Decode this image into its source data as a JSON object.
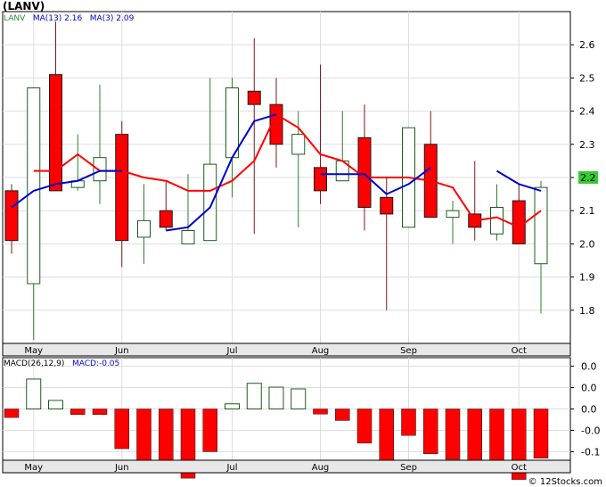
{
  "title": "(LANV)",
  "legend": {
    "symbol": "LANV",
    "ma13": "MA(13)  2.16",
    "ma3": "MA(3)  2.09",
    "macd_params": "MACD(26,12,9)",
    "macd_value": "MACD:-0.05"
  },
  "copyright": "© 12Stocks.com",
  "colors": {
    "up": "#ffffff",
    "up_stroke": "#1a5c1a",
    "down": "#ff0000",
    "down_stroke": "#1a1a1a",
    "wick_up": "#2e7d2e",
    "wick_down": "#7a1a1a",
    "ma13": "#ff0000",
    "ma3": "#0000cc",
    "grid": "#dddddd",
    "price_tag_bg": "#33cc33"
  },
  "chart_data": [
    {
      "type": "candlestick",
      "name": "price",
      "ylim": [
        1.7,
        2.7
      ],
      "yticks": [
        1.8,
        1.9,
        2.0,
        2.1,
        2.2,
        2.3,
        2.4,
        2.5,
        2.6
      ],
      "yticklabels": [
        "1.8",
        "1.9",
        "2.0",
        "2.1",
        "2.2",
        "2.3",
        "2.4",
        "2.5",
        "2.6"
      ],
      "last_price_label": "2.2",
      "last_price": 2.2,
      "xticklabels": [
        "May",
        "Jun",
        "Jul",
        "Aug",
        "Sep",
        "Oct"
      ],
      "candles": [
        {
          "i": 0,
          "o": 2.16,
          "h": 2.18,
          "l": 1.97,
          "c": 2.01
        },
        {
          "i": 1,
          "o": 1.88,
          "h": 2.47,
          "l": 1.71,
          "c": 2.47
        },
        {
          "i": 2,
          "o": 2.51,
          "h": 2.67,
          "l": 2.16,
          "c": 2.16
        },
        {
          "i": 3,
          "o": 2.17,
          "h": 2.33,
          "l": 2.16,
          "c": 2.19
        },
        {
          "i": 4,
          "o": 2.19,
          "h": 2.48,
          "l": 2.12,
          "c": 2.26
        },
        {
          "i": 5,
          "o": 2.33,
          "h": 2.37,
          "l": 1.93,
          "c": 2.01
        },
        {
          "i": 6,
          "o": 2.02,
          "h": 2.18,
          "l": 1.94,
          "c": 2.07
        },
        {
          "i": 7,
          "o": 2.1,
          "h": 2.19,
          "l": 2.04,
          "c": 2.05
        },
        {
          "i": 8,
          "o": 2.0,
          "h": 2.21,
          "l": 2.0,
          "c": 2.04
        },
        {
          "i": 9,
          "o": 2.01,
          "h": 2.5,
          "l": 2.01,
          "c": 2.24
        },
        {
          "i": 10,
          "o": 2.26,
          "h": 2.5,
          "l": 2.14,
          "c": 2.47
        },
        {
          "i": 11,
          "o": 2.46,
          "h": 2.62,
          "l": 2.03,
          "c": 2.42
        },
        {
          "i": 12,
          "o": 2.42,
          "h": 2.5,
          "l": 2.23,
          "c": 2.3
        },
        {
          "i": 13,
          "o": 2.27,
          "h": 2.4,
          "l": 2.05,
          "c": 2.33
        },
        {
          "i": 14,
          "o": 2.23,
          "h": 2.54,
          "l": 2.12,
          "c": 2.16
        },
        {
          "i": 15,
          "o": 2.19,
          "h": 2.4,
          "l": 2.19,
          "c": 2.25
        },
        {
          "i": 16,
          "o": 2.32,
          "h": 2.42,
          "l": 2.04,
          "c": 2.11
        },
        {
          "i": 17,
          "o": 2.14,
          "h": 2.2,
          "l": 1.8,
          "c": 2.09
        },
        {
          "i": 18,
          "o": 2.05,
          "h": 2.35,
          "l": 2.05,
          "c": 2.35
        },
        {
          "i": 19,
          "o": 2.3,
          "h": 2.4,
          "l": 2.08,
          "c": 2.08
        },
        {
          "i": 20,
          "o": 2.08,
          "h": 2.13,
          "l": 2.0,
          "c": 2.1
        },
        {
          "i": 21,
          "o": 2.09,
          "h": 2.25,
          "l": 2.01,
          "c": 2.05
        },
        {
          "i": 22,
          "o": 2.03,
          "h": 2.18,
          "l": 2.01,
          "c": 2.11
        },
        {
          "i": 23,
          "o": 2.13,
          "h": 2.18,
          "l": 2.0,
          "c": 2.0
        },
        {
          "i": 24,
          "o": 1.94,
          "h": 2.19,
          "l": 1.79,
          "c": 2.17
        }
      ],
      "ma13": [
        {
          "i": 1,
          "v": 2.22
        },
        {
          "i": 2,
          "v": 2.22
        },
        {
          "i": 3,
          "v": 2.27
        },
        {
          "i": 4,
          "v": 2.22
        },
        {
          "i": 5,
          "v": 2.22
        },
        {
          "i": 6,
          "v": 2.2
        },
        {
          "i": 7,
          "v": 2.19
        },
        {
          "i": 8,
          "v": 2.16
        },
        {
          "i": 9,
          "v": 2.16
        },
        {
          "i": 10,
          "v": 2.19
        },
        {
          "i": 11,
          "v": 2.25
        },
        {
          "i": 12,
          "v": 2.39
        },
        {
          "i": 13,
          "v": 2.35
        },
        {
          "i": 14,
          "v": 2.27
        },
        {
          "i": 15,
          "v": 2.25
        },
        {
          "i": 16,
          "v": 2.2
        },
        {
          "i": 17,
          "v": 2.2
        },
        {
          "i": 18,
          "v": 2.2
        },
        {
          "i": 19,
          "v": 2.19
        },
        {
          "i": 20,
          "v": 2.17
        },
        {
          "i": 21,
          "v": 2.07
        },
        {
          "i": 22,
          "v": 2.08
        },
        {
          "i": 23,
          "v": 2.05
        },
        {
          "i": 24,
          "v": 2.1
        }
      ],
      "ma3": [
        {
          "i": 0,
          "v": 2.11
        },
        {
          "i": 1,
          "v": 2.16
        },
        {
          "i": 2,
          "v": 2.18
        },
        {
          "i": 3,
          "v": 2.19
        },
        {
          "i": 4,
          "v": 2.22
        },
        {
          "i": 5,
          "v": 2.22
        },
        {
          "i": 7,
          "v": 2.04
        },
        {
          "i": 8,
          "v": 2.05
        },
        {
          "i": 9,
          "v": 2.11
        },
        {
          "i": 10,
          "v": 2.26
        },
        {
          "i": 11,
          "v": 2.37
        },
        {
          "i": 12,
          "v": 2.39
        },
        {
          "i": 14,
          "v": 2.21
        },
        {
          "i": 15,
          "v": 2.21
        },
        {
          "i": 16,
          "v": 2.21
        },
        {
          "i": 17,
          "v": 2.15
        },
        {
          "i": 18,
          "v": 2.18
        },
        {
          "i": 19,
          "v": 2.23
        },
        {
          "i": 22,
          "v": 2.22
        },
        {
          "i": 23,
          "v": 2.18
        },
        {
          "i": 24,
          "v": 2.16
        }
      ]
    },
    {
      "type": "bar",
      "name": "macd",
      "ylim": [
        -0.12,
        0.12
      ],
      "yticks": [
        0.1,
        0.05,
        0.0,
        -0.05,
        -0.1
      ],
      "yticklabels": [
        "0.0",
        "0.0",
        "0.0",
        "-0.0",
        "-0.1"
      ],
      "values": [
        {
          "i": 0,
          "v": -0.02
        },
        {
          "i": 1,
          "v": 0.07
        },
        {
          "i": 2,
          "v": 0.02
        },
        {
          "i": 3,
          "v": -0.013
        },
        {
          "i": 4,
          "v": -0.013
        },
        {
          "i": 5,
          "v": -0.093
        },
        {
          "i": 6,
          "v": -0.127
        },
        {
          "i": 7,
          "v": -0.149
        },
        {
          "i": 8,
          "v": -0.162
        },
        {
          "i": 9,
          "v": -0.1
        },
        {
          "i": 10,
          "v": 0.012
        },
        {
          "i": 11,
          "v": 0.06
        },
        {
          "i": 12,
          "v": 0.051
        },
        {
          "i": 13,
          "v": 0.047
        },
        {
          "i": 14,
          "v": -0.012
        },
        {
          "i": 15,
          "v": -0.027
        },
        {
          "i": 16,
          "v": -0.08
        },
        {
          "i": 17,
          "v": -0.121
        },
        {
          "i": 18,
          "v": -0.062
        },
        {
          "i": 19,
          "v": -0.105
        },
        {
          "i": 20,
          "v": -0.118
        },
        {
          "i": 21,
          "v": -0.149
        },
        {
          "i": 22,
          "v": -0.139
        },
        {
          "i": 23,
          "v": -0.165
        },
        {
          "i": 24,
          "v": -0.115
        }
      ]
    }
  ]
}
